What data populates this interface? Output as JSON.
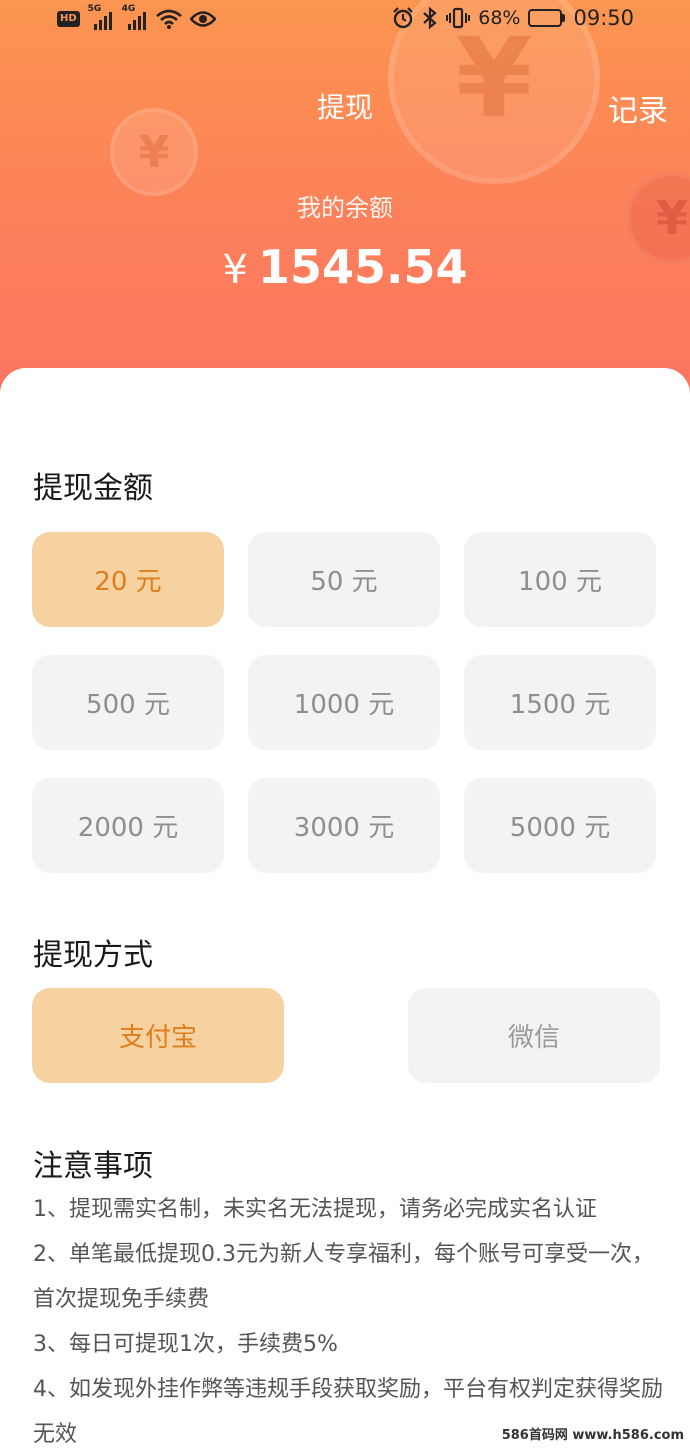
{
  "status_bar": {
    "hd": "HD",
    "net1": "5G",
    "net2": "4G",
    "battery_pct": "68%",
    "battery_level": 0.68,
    "time": "09:50"
  },
  "header": {
    "title": "提现",
    "records_label": "记录",
    "balance_label": "我的余额",
    "currency": "¥",
    "balance": "1545.54",
    "coin_glyph": "¥"
  },
  "amount_section": {
    "title": "提现金额",
    "options": [
      "20 元",
      "50 元",
      "100 元",
      "500 元",
      "1000 元",
      "1500 元",
      "2000 元",
      "3000 元",
      "5000 元"
    ],
    "selected": "20 元"
  },
  "method_section": {
    "title": "提现方式",
    "alipay": "支付宝",
    "wechat": "微信",
    "selected": "支付宝"
  },
  "notes": {
    "title": "注意事项",
    "items": [
      "1、提现需实名制，未实名无法提现，请务必完成实名认证",
      "2、单笔最低提现0.3元为新人专享福利，每个账号可享受一次，首次提现免手续费",
      "3、每日可提现1次，手续费5%",
      "4、如发现外挂作弊等违规手段获取奖励，平台有权判定获得奖励无效"
    ]
  },
  "watermark": "586首码网 www.h586.com",
  "colors": {
    "header_top": "#fb9550",
    "header_bottom": "#fd7462",
    "selected_bg": "#f5d2a0",
    "selected_text": "#e07d1e",
    "unselected_bg": "#f3f3f1"
  }
}
